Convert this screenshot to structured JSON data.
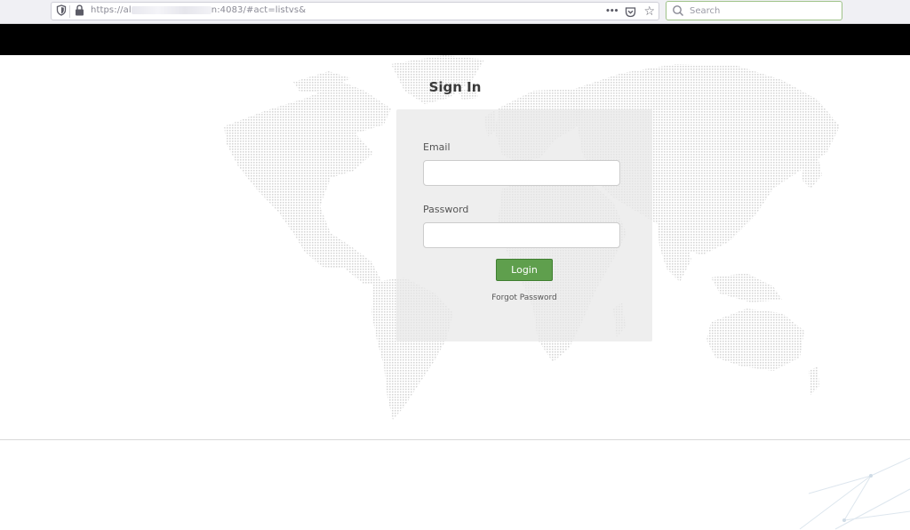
{
  "browser": {
    "url_visible_start": "https://al",
    "url_visible_end": "n:4083/#act=listvs&",
    "search_placeholder": "Search",
    "more_icon": "•••",
    "bookmark_icon": "☆"
  },
  "signin": {
    "title": "Sign In",
    "email_label": "Email",
    "email_value": "",
    "password_label": "Password",
    "password_value": "",
    "login_button": "Login",
    "forgot_link": "Forgot Password"
  },
  "colors": {
    "header_band": "#000000",
    "login_button": "#5f9f4d",
    "panel": "#e8e8e8",
    "map_dots": "#d7d7d7"
  }
}
